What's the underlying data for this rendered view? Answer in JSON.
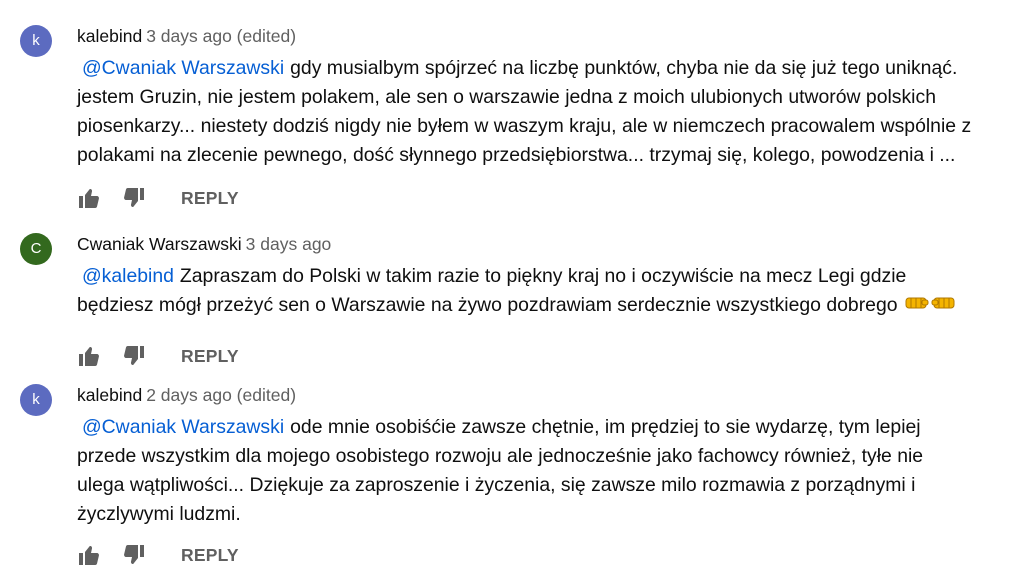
{
  "colors": {
    "avatar_k": "#5c6bc0",
    "avatar_c": "#33691e",
    "mention": "#065fd4",
    "meta": "#606060"
  },
  "comments": [
    {
      "avatar_letter": "k",
      "author": "kalebind",
      "time": "3 days ago (edited)",
      "mention": "@Cwaniak Warszawski",
      "lines": [
        "gdy musialbym spójrzeć na liczbę punktów, chyba nie da się już tego uniknąć.",
        "jestem Gruzin, nie jestem polakem, ale sen o warszawie jedna z moich ulubionych utworów polskich",
        "piosenkarzy... niestety dodziś nigdy nie byłem w waszym kraju, ale w niemczech pracowalem wspólnie z",
        "polakami na zlecenie pewnego, dość słynnego przedsiębiorstwa... trzymaj się, kolego, powodzenia i ..."
      ],
      "reply": "REPLY"
    },
    {
      "avatar_letter": "C",
      "author": "Cwaniak Warszawski",
      "time": "3 days ago",
      "mention": "@kalebind",
      "lines": [
        "Zapraszam do Polski w takim razie to piękny kraj no i oczywiście na mecz Legi gdzie",
        "będziesz mógł przeżyć sen o Warszawie na żywo pozdrawiam serdecznie wszystkiego dobrego"
      ],
      "emojis": [
        "fist-bump-left-icon",
        "fist-bump-right-icon"
      ],
      "reply": "REPLY"
    },
    {
      "avatar_letter": "k",
      "author": "kalebind",
      "time": "2 days ago (edited)",
      "mention": "@Cwaniak Warszawski",
      "lines": [
        "ode mnie osobiśćie zawsze chętnie, im prędziej to sie wydarzę, tym lepiej",
        "przede wszystkim dla  mojego osobistego rozwoju ale jednocześnie jako fachowcy  również, tyłe nie",
        "ulega wątpliwości... Dziękuje za zaproszenie i życzenia, się zawsze milo rozmawia z   porządnymi i",
        "życzlywymi ludzmi."
      ],
      "reply": "REPLY"
    }
  ]
}
